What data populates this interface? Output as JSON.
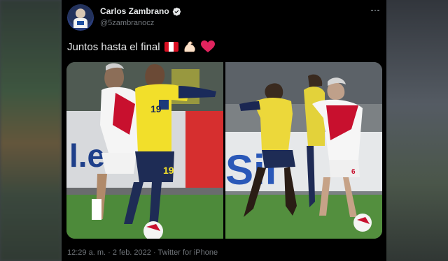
{
  "user": {
    "name": "Carlos Zambrano",
    "handle": "@5zambranocz",
    "verified": true
  },
  "tweet": {
    "text": "Juntos hasta el final",
    "emojis": [
      "peru-flag-icon",
      "flexed-biceps-icon",
      "red-heart-icon"
    ],
    "colors": {
      "flag_red": "#d91023",
      "heart_red": "#f91880",
      "verified_blue": "#1d9bf0"
    }
  },
  "media": {
    "photos": [
      {
        "shirt_number_yellow": "19"
      },
      {
        "shirt_number_white": "6"
      }
    ],
    "background_text": [
      "l.e",
      "Sil"
    ]
  },
  "meta": {
    "time": "12:29 a. m.",
    "separator": "·",
    "date": "2 feb. 2022",
    "source": "Twitter for iPhone"
  }
}
